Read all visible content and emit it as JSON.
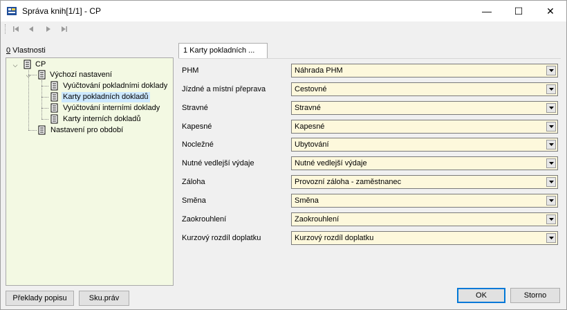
{
  "window": {
    "title": "Správa knih[1/1] - CP",
    "minimize_glyph": "—",
    "maximize_glyph": "☐",
    "close_glyph": "✕"
  },
  "nav": {
    "first_icon": "first-record-icon",
    "prev_icon": "prev-record-icon",
    "next_icon": "next-record-icon",
    "last_icon": "last-record-icon"
  },
  "properties": {
    "label_accel": "0",
    "label_rest": " Vlastnosti"
  },
  "tree": {
    "root": "CP",
    "defaults": "Výchozí nastavení",
    "children": [
      "Vyúčtování pokladními doklady",
      "Karty pokladních dokladů",
      "Vyúčtování interními doklady",
      "Karty interních dokladů"
    ],
    "selected_index": 1,
    "period": "Nastavení pro období"
  },
  "buttons": {
    "translations": "Překlady popisu",
    "rights": "Sku.práv",
    "ok": "OK",
    "cancel": "Storno"
  },
  "tab": {
    "label": "1 Karty pokladních ..."
  },
  "form": [
    {
      "label": "PHM",
      "value": "Náhrada PHM"
    },
    {
      "label": "Jízdné a místní přeprava",
      "value": "Cestovné"
    },
    {
      "label": "Stravné",
      "value": "Stravné"
    },
    {
      "label": "Kapesné",
      "value": "Kapesné"
    },
    {
      "label": "Nocležné",
      "value": "Ubytování"
    },
    {
      "label": "Nutné vedlejší výdaje",
      "value": "Nutné vedlejší výdaje"
    },
    {
      "label": "Záloha",
      "value": "Provozní záloha - zaměstnanec"
    },
    {
      "label": "Směna",
      "value": "Směna"
    },
    {
      "label": "Zaokrouhlení",
      "value": "Zaokrouhlení"
    },
    {
      "label": "Kurzový rozdíl doplatku",
      "value": "Kurzový rozdíl doplatku"
    }
  ],
  "colors": {
    "tree_bg": "#f3f9e3",
    "combo_bg": "#fdf8dc",
    "selection": "#cce8ff",
    "default_button_border": "#0078d7"
  }
}
